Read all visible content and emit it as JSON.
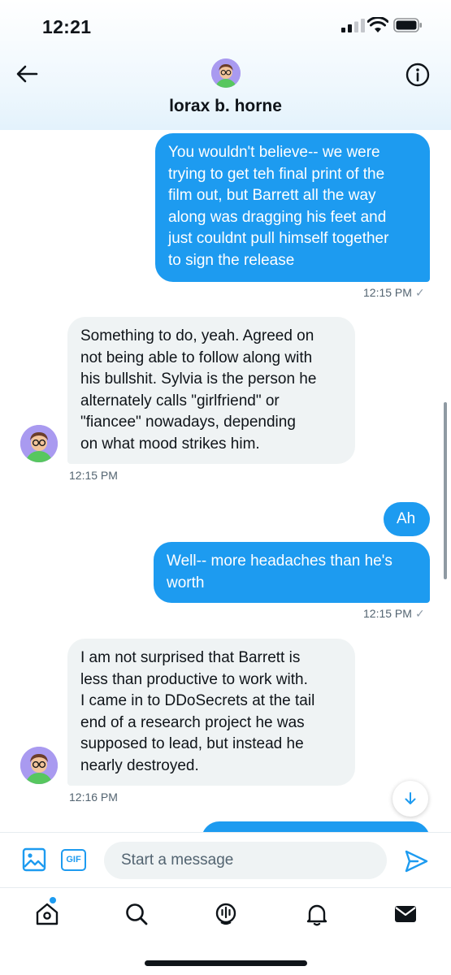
{
  "status_bar": {
    "time": "12:21"
  },
  "header": {
    "contact_name": "lorax b. horne",
    "back_icon": "arrow-left-icon",
    "info_icon": "info-icon"
  },
  "messages": [
    {
      "direction": "outgoing",
      "lines": [
        "You wouldn't believe-- we were",
        "trying to get teh final print of the",
        "film out, but Barrett all the way",
        "along was dragging his feet and",
        "just couldnt pull himself together",
        "to sign the release"
      ],
      "timestamp": "12:15 PM",
      "read_icon": "✓"
    },
    {
      "direction": "incoming",
      "lines": [
        "Something to do, yeah. Agreed on",
        "not being able to follow along with",
        "his bullshit. Sylvia is the person he",
        "alternately calls \"girlfriend\" or",
        "\"fiancee\" nowadays, depending",
        "on what  mood strikes him."
      ],
      "timestamp": "12:15 PM"
    },
    {
      "direction": "outgoing",
      "lines": [
        "Ah"
      ]
    },
    {
      "direction": "outgoing",
      "lines": [
        "Well-- more headaches than he's",
        "worth"
      ],
      "timestamp": "12:15 PM",
      "read_icon": "✓"
    },
    {
      "direction": "incoming",
      "lines": [
        "I am not surprised that Barrett is",
        "less than productive to work with.",
        "I came in to DDoSecrets at the tail",
        "end of a research project he was",
        "supposed to lead, but instead he",
        "nearly destroyed."
      ],
      "timestamp": "12:16 PM"
    }
  ],
  "composer": {
    "placeholder": "Start a message",
    "gif_label": "GIF",
    "media_icon": "image-icon",
    "send_icon": "send-icon"
  },
  "bottom_nav": [
    {
      "name": "home",
      "icon": "home-icon",
      "has_notification_dot": true
    },
    {
      "name": "search",
      "icon": "search-icon"
    },
    {
      "name": "spaces",
      "icon": "spaces-icon"
    },
    {
      "name": "notifications",
      "icon": "bell-icon"
    },
    {
      "name": "messages",
      "icon": "envelope-icon",
      "active": true
    }
  ],
  "colors": {
    "accent": "#1d9bf0",
    "incoming_bubble": "#eff3f4",
    "text": "#0f1419",
    "muted": "#536471"
  }
}
